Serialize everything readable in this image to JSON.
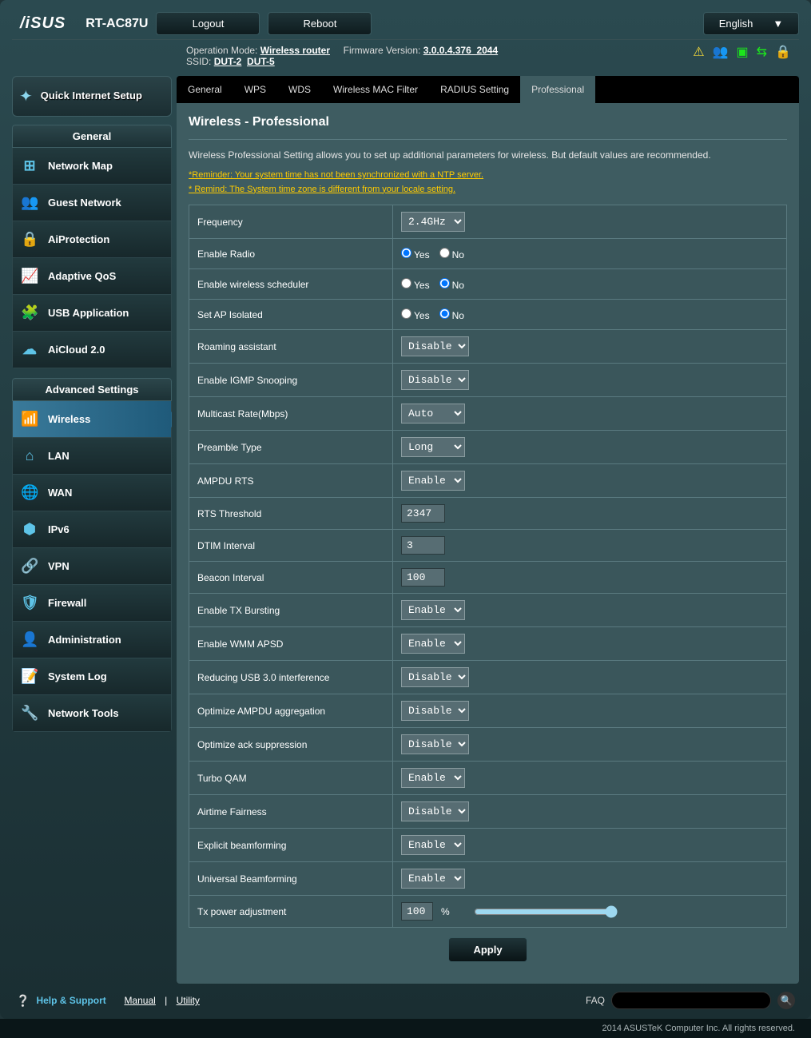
{
  "header": {
    "brand": "/iSUS",
    "model": "RT-AC87U",
    "logout": "Logout",
    "reboot": "Reboot",
    "language": "English"
  },
  "status": {
    "op_mode_label": "Operation Mode:",
    "op_mode_value": "Wireless router",
    "fw_label": "Firmware Version:",
    "fw_value": "3.0.0.4.376_2044",
    "ssid_label": "SSID:",
    "ssid1": "DUT-2",
    "ssid2": "DUT-5"
  },
  "sidebar": {
    "qis": "Quick Internet Setup",
    "general_head": "General",
    "general": [
      {
        "icon": "⊞",
        "label": "Network Map"
      },
      {
        "icon": "👥",
        "label": "Guest Network"
      },
      {
        "icon": "🔒",
        "label": "AiProtection"
      },
      {
        "icon": "📈",
        "label": "Adaptive QoS"
      },
      {
        "icon": "🧩",
        "label": "USB Application"
      },
      {
        "icon": "☁",
        "label": "AiCloud 2.0"
      }
    ],
    "advanced_head": "Advanced Settings",
    "advanced": [
      {
        "icon": "📶",
        "label": "Wireless",
        "active": true
      },
      {
        "icon": "⌂",
        "label": "LAN"
      },
      {
        "icon": "🌐",
        "label": "WAN"
      },
      {
        "icon": "⬢",
        "label": "IPv6"
      },
      {
        "icon": "🔗",
        "label": "VPN"
      },
      {
        "icon": "🛡",
        "label": "Firewall"
      },
      {
        "icon": "👤",
        "label": "Administration"
      },
      {
        "icon": "📝",
        "label": "System Log"
      },
      {
        "icon": "🔧",
        "label": "Network Tools"
      }
    ]
  },
  "tabs": [
    "General",
    "WPS",
    "WDS",
    "Wireless MAC Filter",
    "RADIUS Setting",
    "Professional"
  ],
  "active_tab": 5,
  "panel": {
    "title": "Wireless - Professional",
    "desc": "Wireless Professional Setting allows you to set up additional parameters for wireless. But default values are recommended.",
    "reminder1": "*Reminder: Your system time has not been synchronized with a NTP server.",
    "reminder2": "* Remind: The System time zone is different from your locale setting."
  },
  "radio_labels": {
    "yes": "Yes",
    "no": "No"
  },
  "apply": "Apply",
  "footer": {
    "help": "Help & Support",
    "manual": "Manual",
    "utility": "Utility",
    "faq": "FAQ",
    "copyright": "2014 ASUSTeK Computer Inc. All rights reserved."
  },
  "settings": [
    {
      "label": "Frequency",
      "type": "select",
      "value": "2.4GHz"
    },
    {
      "label": "Enable Radio",
      "type": "radio",
      "value": "Yes"
    },
    {
      "label": "Enable wireless scheduler",
      "type": "radio",
      "value": "No"
    },
    {
      "label": "Set AP Isolated",
      "type": "radio",
      "value": "No"
    },
    {
      "label": "Roaming assistant",
      "type": "select",
      "value": "Disable"
    },
    {
      "label": "Enable IGMP Snooping",
      "type": "select",
      "value": "Disable"
    },
    {
      "label": "Multicast Rate(Mbps)",
      "type": "select",
      "value": "Auto"
    },
    {
      "label": "Preamble Type",
      "type": "select",
      "value": "Long"
    },
    {
      "label": "AMPDU RTS",
      "type": "select",
      "value": "Enable"
    },
    {
      "label": "RTS Threshold",
      "type": "text",
      "value": "2347"
    },
    {
      "label": "DTIM Interval",
      "type": "text",
      "value": "3"
    },
    {
      "label": "Beacon Interval",
      "type": "text",
      "value": "100"
    },
    {
      "label": "Enable TX Bursting",
      "type": "select",
      "value": "Enable"
    },
    {
      "label": "Enable WMM APSD",
      "type": "select",
      "value": "Enable"
    },
    {
      "label": "Reducing USB 3.0 interference",
      "type": "select",
      "value": "Disable"
    },
    {
      "label": "Optimize AMPDU aggregation",
      "type": "select",
      "value": "Disable"
    },
    {
      "label": "Optimize ack suppression",
      "type": "select",
      "value": "Disable"
    },
    {
      "label": "Turbo QAM",
      "type": "select",
      "value": "Enable"
    },
    {
      "label": "Airtime Fairness",
      "type": "select",
      "value": "Disable"
    },
    {
      "label": "Explicit beamforming",
      "type": "select",
      "value": "Enable"
    },
    {
      "label": "Universal Beamforming",
      "type": "select",
      "value": "Enable"
    },
    {
      "label": "Tx power adjustment",
      "type": "range",
      "value": "100",
      "suffix": "%"
    }
  ]
}
